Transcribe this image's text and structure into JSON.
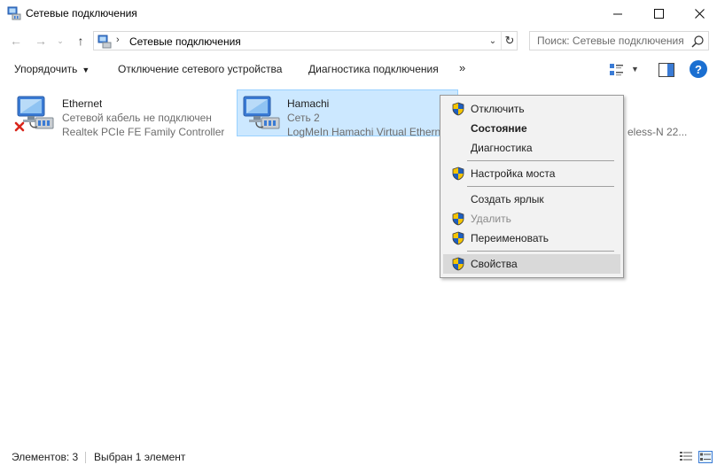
{
  "window": {
    "title": "Сетевые подключения",
    "minimize_glyph": "—",
    "maximize_glyph": "☐",
    "close_glyph": "✕"
  },
  "nav": {
    "back_glyph": "←",
    "forward_glyph": "→",
    "recent_glyph": "⌄",
    "up_glyph": "↑",
    "address_separator": "›",
    "address_text": "Сетевые подключения",
    "address_dropdown_glyph": "⌄",
    "refresh_glyph": "↻",
    "search_placeholder": "Поиск: Сетевые подключения"
  },
  "commandbar": {
    "organize_label": "Упорядочить",
    "organize_caret": "▼",
    "disable_label": "Отключение сетевого устройства",
    "diagnose_label": "Диагностика подключения",
    "more_glyph": "»",
    "view_drop_glyph": "▼",
    "help_glyph": "?"
  },
  "connections": [
    {
      "name": "Ethernet",
      "status": "Сетевой кабель не подключен",
      "device": "Realtek PCIe FE Family Controller"
    },
    {
      "name": "Hamachi",
      "status": "Сеть  2",
      "device": "LogMeIn Hamachi Virtual Ethernet Adapter"
    },
    {
      "name": "",
      "status": "",
      "device": "eless-N 22..."
    }
  ],
  "context_menu": {
    "items": [
      {
        "label": "Отключить",
        "shield": true
      },
      {
        "label": "Состояние",
        "shield": false,
        "bold": true
      },
      {
        "label": "Диагностика",
        "shield": false
      },
      {
        "label": "Настройка моста",
        "shield": true
      },
      {
        "label": "Создать ярлык",
        "shield": false
      },
      {
        "label": "Удалить",
        "shield": true,
        "disabled": true
      },
      {
        "label": "Переименовать",
        "shield": true
      },
      {
        "label": "Свойства",
        "shield": true,
        "hovered": true
      }
    ]
  },
  "statusbar": {
    "count": "Элементов: 3",
    "selected": "Выбран 1 элемент"
  },
  "colors": {
    "selection_bg": "#cce8ff",
    "selection_border": "#99d1ff",
    "menu_bg": "#f2f2f2",
    "menu_hover": "#d9d9d9",
    "help_blue": "#1a6fd1",
    "error_red": "#d9261c"
  }
}
